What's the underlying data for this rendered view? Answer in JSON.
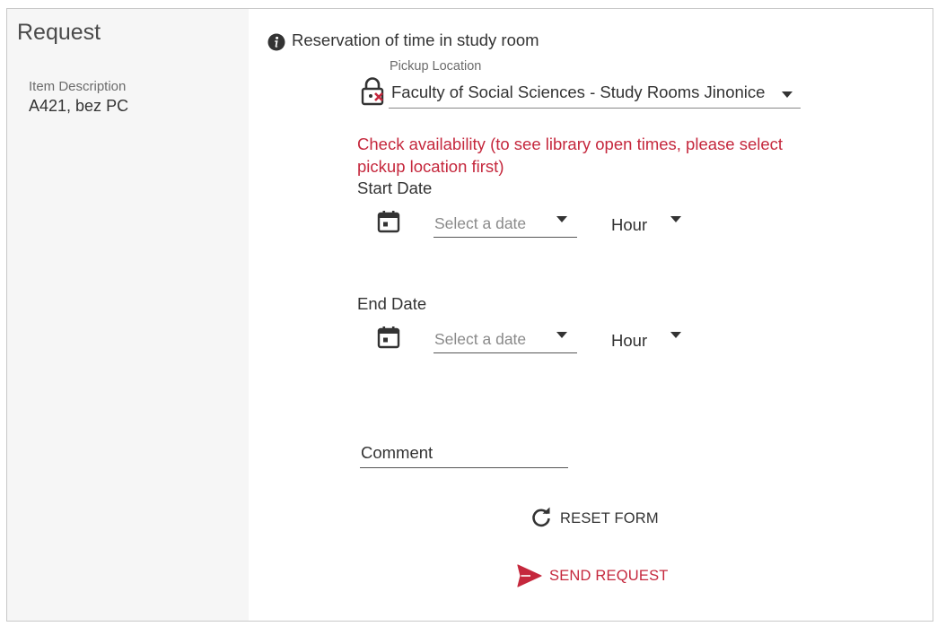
{
  "sidebar": {
    "title": "Request",
    "item_description_label": "Item Description",
    "item_description_value": "A421, bez PC"
  },
  "form": {
    "title": "Reservation of time in study room",
    "title_icon": "info-icon",
    "pickup": {
      "label": "Pickup Location",
      "value": "Faculty of Social Sciences - Study Rooms Jinonice",
      "icon": "lock-icon"
    },
    "availability_note": "Check availability (to see library open times, please select pickup location first)",
    "start": {
      "label": "Start Date",
      "date_placeholder": "Select a date",
      "hour_label": "Hour"
    },
    "end": {
      "label": "End Date",
      "date_placeholder": "Select a date",
      "hour_label": "Hour"
    },
    "comment_label": "Comment",
    "reset_label": "RESET FORM",
    "send_label": "SEND REQUEST"
  },
  "colors": {
    "accent": "#c5283d",
    "text": "#333333",
    "sidebar_bg": "#f6f6f6",
    "border": "#c8c8c8"
  }
}
